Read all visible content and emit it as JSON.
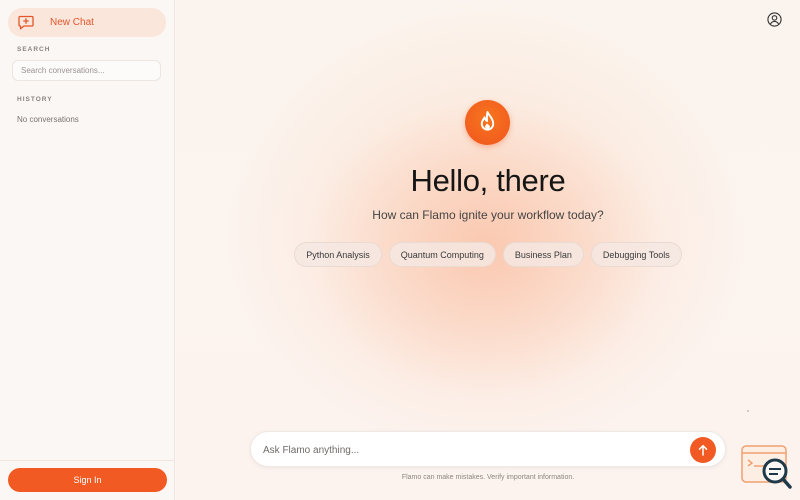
{
  "sidebar": {
    "new_chat_label": "New Chat",
    "search_title": "SEARCH",
    "search_placeholder": "Search conversations...",
    "history_title": "HISTORY",
    "history_empty": "No conversations",
    "sign_in_label": "Sign In"
  },
  "main": {
    "headline": "Hello, there",
    "subline": "How can Flamo ignite your workflow today?",
    "suggestions": [
      "Python Analysis",
      "Quantum Computing",
      "Business Plan",
      "Debugging Tools"
    ],
    "composer_placeholder": "Ask Flamo anything...",
    "disclaimer": "Flamo can make mistakes. Verify important information."
  },
  "icons": {
    "new_chat": "new-chat-icon",
    "user": "user-icon",
    "logo": "flame-icon",
    "send": "arrow-up-icon",
    "widget": "search-overlay-icon"
  },
  "colors": {
    "accent": "#f25a24",
    "accent_light": "#fbe6dc"
  }
}
